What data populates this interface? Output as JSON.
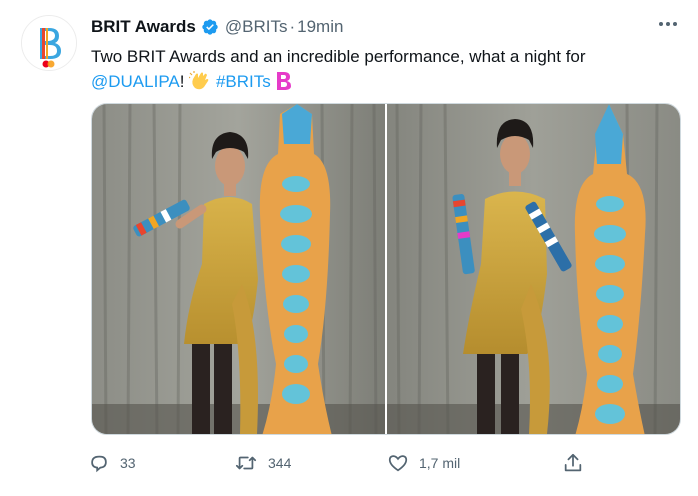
{
  "account": {
    "name": "BRIT Awards",
    "handle": "@BRITs",
    "separator": "·",
    "time": "19min"
  },
  "tweet": {
    "text_part1": "Two BRIT Awards and an incredible performance, what a night for",
    "mention": "@DUALIPA",
    "text_part2": "!",
    "hashtag": "#BRITs"
  },
  "media": {
    "count": 2
  },
  "actions": {
    "reply_count": "33",
    "retweet_count": "344",
    "like_count": "1,7 mil"
  },
  "colors": {
    "accent": "#1d9bf0",
    "secondary_text": "#536471",
    "brit_pink": "#e63bc9"
  },
  "icons": [
    "verified-badge-icon",
    "more-options-icon",
    "clapping-hands-icon",
    "brit-logo-icon",
    "reply-icon",
    "retweet-icon",
    "like-icon",
    "share-icon"
  ]
}
